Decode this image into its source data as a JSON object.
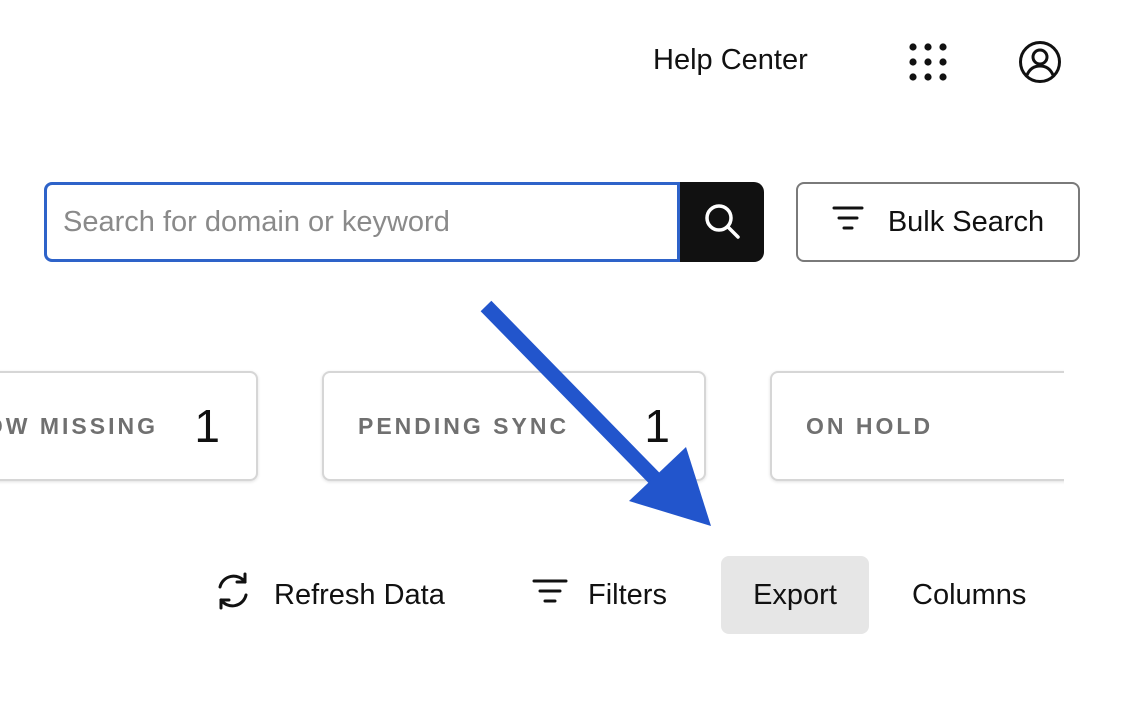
{
  "header": {
    "help_label": "Help Center",
    "apps_icon": "grid-dots-icon",
    "account_icon": "user-circle-icon"
  },
  "search": {
    "placeholder": "Search for domain or keyword",
    "value": "",
    "button_icon": "search-icon",
    "bulk_label": "Bulk Search",
    "bulk_icon": "filter-lines-icon"
  },
  "status_cards": [
    {
      "label": "OW MISSING",
      "count": "1"
    },
    {
      "label": "PENDING SYNC",
      "count": "1"
    },
    {
      "label": "ON HOLD",
      "count": ""
    }
  ],
  "toolbar": {
    "refresh_label": "Refresh Data",
    "refresh_icon": "refresh-icon",
    "filters_label": "Filters",
    "filters_icon": "filter-lines-icon",
    "export_label": "Export",
    "columns_label": "Columns"
  },
  "colors": {
    "accent_blue": "#2e63c9",
    "arrow_blue": "#2255cc",
    "search_button_bg": "#111111",
    "export_highlight_bg": "#e6e6e6",
    "card_label_gray": "#707070"
  }
}
